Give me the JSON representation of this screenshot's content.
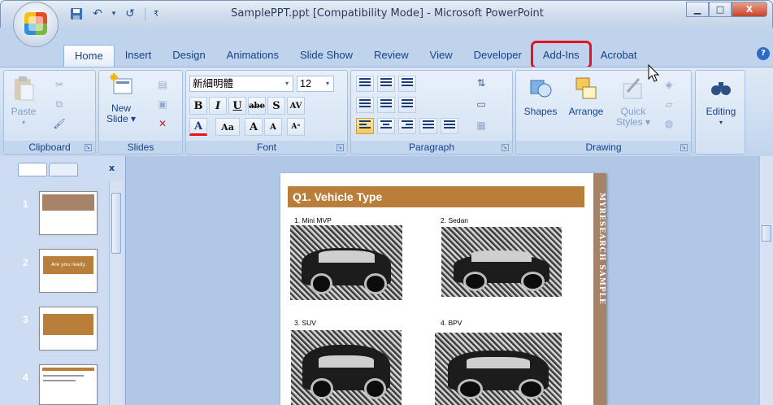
{
  "window": {
    "title": "SamplePPT.ppt [Compatibility Mode] - Microsoft PowerPoint",
    "minimize": "▁",
    "maximize": "□",
    "close": "X"
  },
  "tabs": [
    "Home",
    "Insert",
    "Design",
    "Animations",
    "Slide Show",
    "Review",
    "View",
    "Developer",
    "Add-Ins",
    "Acrobat"
  ],
  "ribbon": {
    "clipboard": {
      "label": "Clipboard",
      "paste": "Paste"
    },
    "slides": {
      "label": "Slides",
      "new_slide_line1": "New",
      "new_slide_line2": "Slide ▾"
    },
    "font": {
      "label": "Font",
      "font_name": "新細明體",
      "font_size": "12"
    },
    "paragraph": {
      "label": "Paragraph"
    },
    "drawing": {
      "label": "Drawing",
      "shapes": "Shapes",
      "arrange": "Arrange",
      "quick_styles_line1": "Quick",
      "quick_styles_line2": "Styles ▾"
    },
    "editing": {
      "label": "Editing"
    }
  },
  "thumbnails": [
    {
      "num": "1",
      "text": "MYRESEARCH SAMPLE"
    },
    {
      "num": "2",
      "text": "Are you ready"
    },
    {
      "num": "3",
      "text": ""
    },
    {
      "num": "4",
      "text": ""
    }
  ],
  "slide": {
    "heading": "Q1. Vehicle Type",
    "side_text": "MYRESEARCH SAMPLE",
    "options": [
      "1. Mini MVP",
      "2. Sedan",
      "3. SUV",
      "4. BPV"
    ]
  },
  "colors": {
    "accent": "#b97f3a",
    "highlight": "#e8101b",
    "ribbon": "#c9daf0"
  }
}
